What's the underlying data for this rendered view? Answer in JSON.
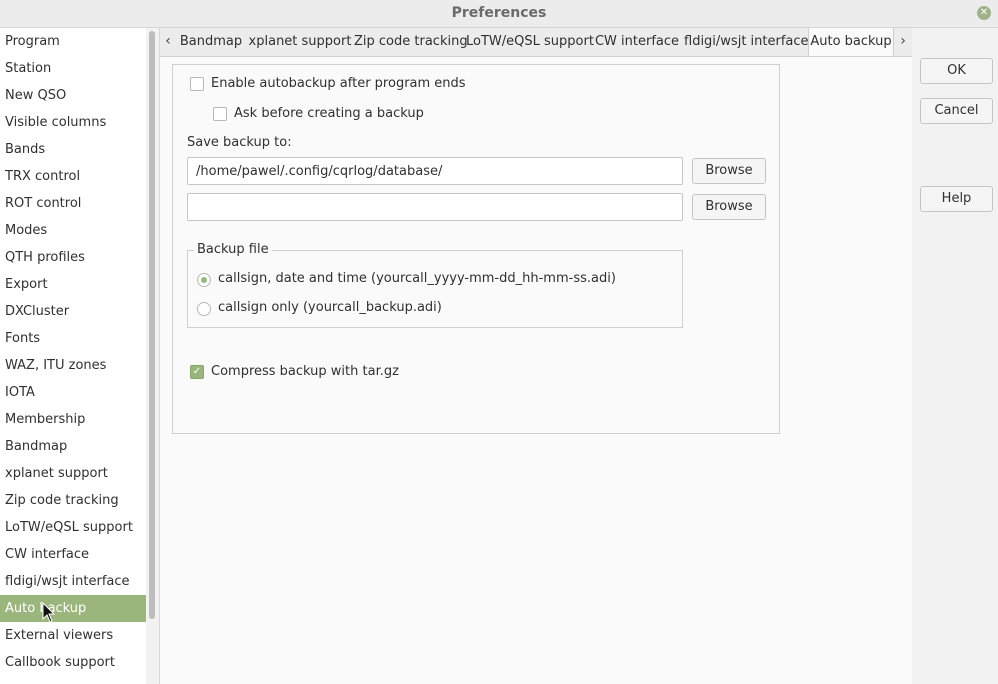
{
  "window": {
    "title": "Preferences"
  },
  "sidebar": {
    "items": [
      {
        "label": "Program"
      },
      {
        "label": "Station"
      },
      {
        "label": "New QSO"
      },
      {
        "label": "Visible columns"
      },
      {
        "label": "Bands"
      },
      {
        "label": "TRX control"
      },
      {
        "label": "ROT control"
      },
      {
        "label": "Modes"
      },
      {
        "label": "QTH profiles"
      },
      {
        "label": "Export"
      },
      {
        "label": "DXCluster"
      },
      {
        "label": "Fonts"
      },
      {
        "label": "WAZ, ITU zones"
      },
      {
        "label": "IOTA"
      },
      {
        "label": "Membership"
      },
      {
        "label": "Bandmap"
      },
      {
        "label": "xplanet support"
      },
      {
        "label": "Zip code tracking"
      },
      {
        "label": "LoTW/eQSL support"
      },
      {
        "label": "CW interface"
      },
      {
        "label": "fldigi/wsjt interface"
      },
      {
        "label": "Auto backup"
      },
      {
        "label": "External viewers"
      },
      {
        "label": "Callbook support"
      }
    ],
    "selected": "Auto backup"
  },
  "tabs": [
    {
      "label": "Bandmap"
    },
    {
      "label": "xplanet support"
    },
    {
      "label": "Zip code tracking"
    },
    {
      "label": "LoTW/eQSL support"
    },
    {
      "label": "CW interface"
    },
    {
      "label": "fldigi/wsjt interface"
    },
    {
      "label": "Auto backup"
    }
  ],
  "autobackup": {
    "enable_label": "Enable autobackup after program ends",
    "enable_checked": false,
    "ask_label": "Ask before creating a backup",
    "ask_checked": false,
    "save_to_label": "Save backup to:",
    "path1_value": "/home/pawel/.config/cqrlog/database/",
    "path2_value": "",
    "browse_label": "Browse",
    "backup_file_title": "Backup file",
    "option_datetime": "callsign, date and time (yourcall_yyyy-mm-dd_hh-mm-ss.adi)",
    "option_callsign": "callsign only (yourcall_backup.adi)",
    "selected_option": "datetime",
    "compress_label": "Compress backup with tar.gz",
    "compress_checked": true
  },
  "buttons": {
    "ok": "OK",
    "cancel": "Cancel",
    "help": "Help"
  },
  "colors": {
    "accent": "#9bb67c"
  }
}
